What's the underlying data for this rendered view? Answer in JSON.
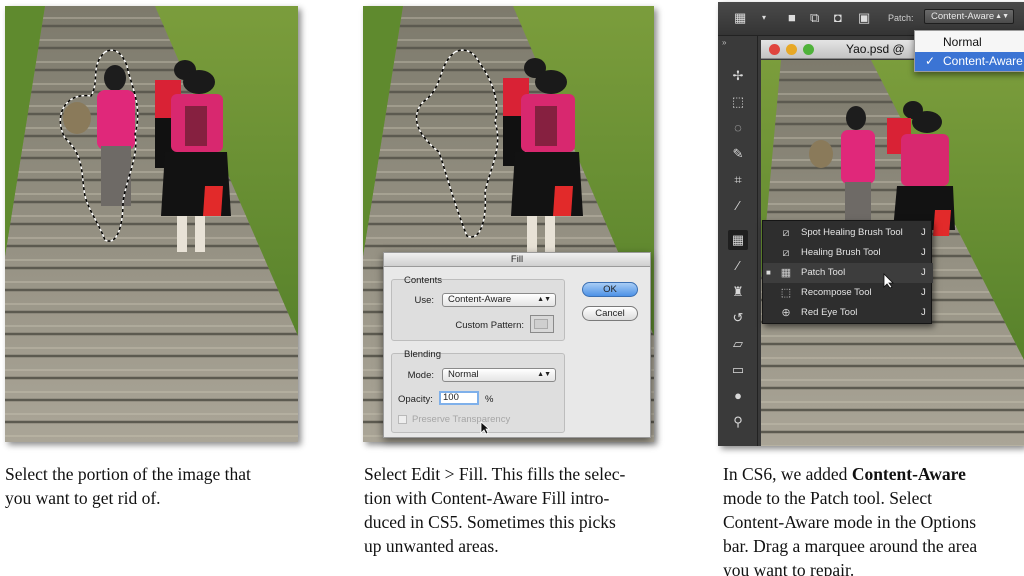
{
  "captions": {
    "first": {
      "line1": "Select the portion of the image that",
      "line2": "you want to get rid of."
    },
    "second": {
      "line1": "Select Edit > Fill. This fills the selec-",
      "line2": "tion with Content-Aware Fill intro-",
      "line3": "duced in CS5. Sometimes this picks",
      "line4": "up unwanted areas."
    },
    "third": {
      "line1_pre": "In CS6, we added ",
      "line1_bold": "Content-Aware",
      "line2": "mode to the Patch tool. Select",
      "line3": "Content-Aware mode in the Options",
      "line4": "bar. Drag a marquee around the area",
      "line5": "you want to repair."
    }
  },
  "fill_dialog": {
    "title": "Fill",
    "contents_label": "Contents",
    "use_label": "Use:",
    "use_value": "Content-Aware",
    "custom_pattern_label": "Custom Pattern:",
    "blending_label": "Blending",
    "mode_label": "Mode:",
    "mode_value": "Normal",
    "opacity_label": "Opacity:",
    "opacity_value": "100",
    "opacity_unit": "%",
    "preserve_label": "Preserve Transparency",
    "ok_label": "OK",
    "cancel_label": "Cancel"
  },
  "photoshop": {
    "patch_label": "Patch:",
    "patch_value": "Content-Aware",
    "patch_menu": [
      "Normal",
      "Content-Aware"
    ],
    "patch_menu_check": "✓",
    "doc_title": "Yao.psd @",
    "tool_flyout": [
      {
        "label": "Spot Healing Brush Tool",
        "key": "J",
        "icon": "spot-healing-brush-icon"
      },
      {
        "label": "Healing Brush Tool",
        "key": "J",
        "icon": "healing-brush-icon"
      },
      {
        "label": "Patch Tool",
        "key": "J",
        "icon": "patch-icon"
      },
      {
        "label": "Recompose Tool",
        "key": "J",
        "icon": "recompose-icon"
      },
      {
        "label": "Red Eye Tool",
        "key": "J",
        "icon": "red-eye-icon"
      }
    ],
    "active_bullet": "■",
    "colors": {
      "selected_blue": "#3b74d4",
      "panel_dark": "#3a3a3a",
      "close_red": "#e0443e",
      "minimize_yellow": "#e7a826",
      "zoom_green": "#4fb23a"
    }
  }
}
